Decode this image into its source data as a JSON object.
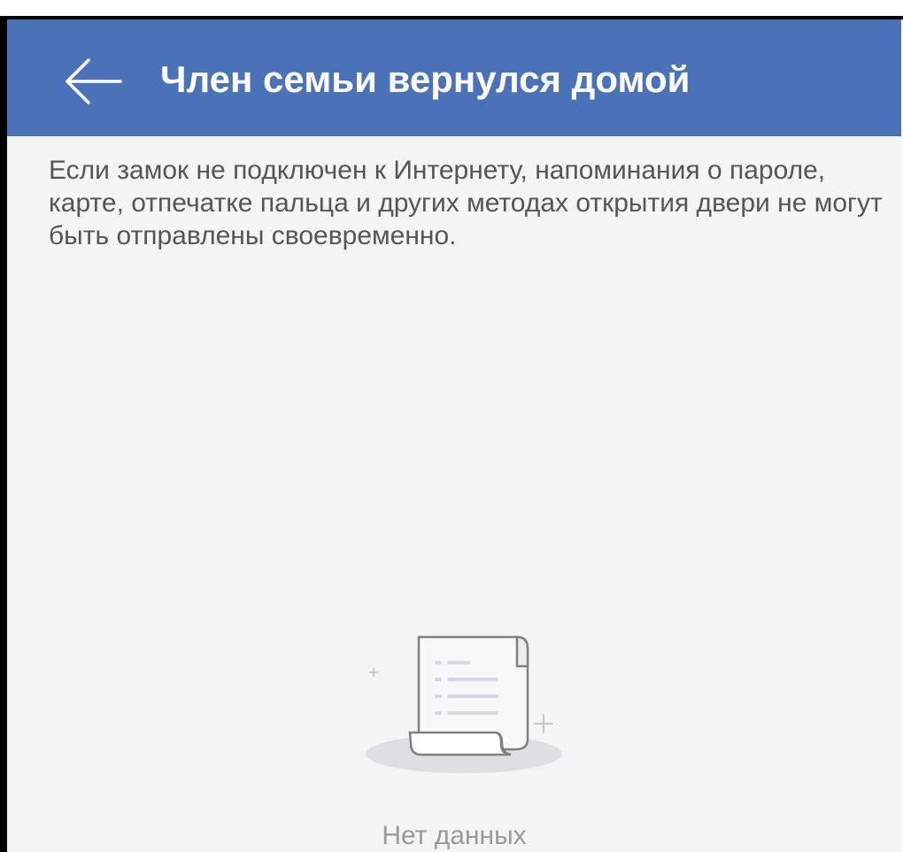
{
  "header": {
    "back_icon": "arrow-left-icon",
    "title": "Член семьи вернулся домой",
    "background_color": "#4a72b8"
  },
  "main": {
    "notice": "Если замок не подключен к Интернету, напоминания о пароле, карте, отпечатке пальца и других методах открытия двери не могут быть отправлены своевременно.",
    "empty_state": {
      "icon": "empty-document-scroll-icon",
      "label": "Нет данных"
    }
  }
}
